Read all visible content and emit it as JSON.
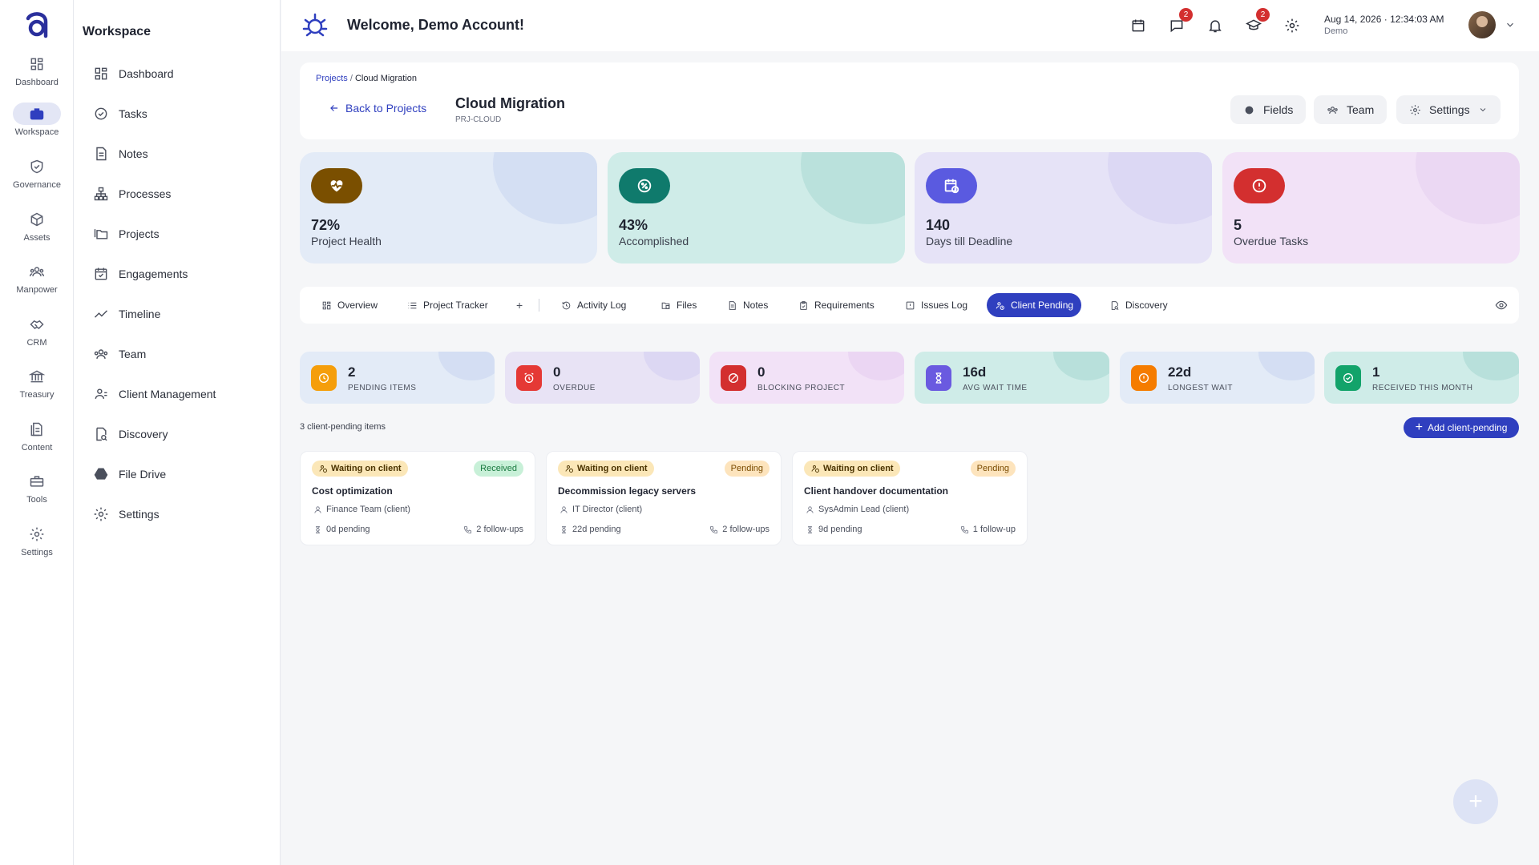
{
  "rail": {
    "items": [
      {
        "label": "Dashboard",
        "icon": "dashboard-icon"
      },
      {
        "label": "Workspace",
        "icon": "briefcase-icon",
        "active": true
      },
      {
        "label": "Governance",
        "icon": "shield-icon"
      },
      {
        "label": "Assets",
        "icon": "cube-icon"
      },
      {
        "label": "Manpower",
        "icon": "people-icon"
      },
      {
        "label": "CRM",
        "icon": "handshake-icon"
      },
      {
        "label": "Treasury",
        "icon": "bank-icon"
      },
      {
        "label": "Content",
        "icon": "document-icon"
      },
      {
        "label": "Tools",
        "icon": "toolbox-icon"
      },
      {
        "label": "Settings",
        "icon": "gear-icon"
      }
    ]
  },
  "sidebar": {
    "title": "Workspace",
    "items": [
      {
        "label": "Dashboard",
        "icon": "dashboard-icon"
      },
      {
        "label": "Tasks",
        "icon": "check-circle-icon"
      },
      {
        "label": "Notes",
        "icon": "note-icon"
      },
      {
        "label": "Processes",
        "icon": "org-chart-icon"
      },
      {
        "label": "Projects",
        "icon": "folders-icon"
      },
      {
        "label": "Engagements",
        "icon": "calendar-check-icon"
      },
      {
        "label": "Timeline",
        "icon": "trend-line-icon"
      },
      {
        "label": "Team",
        "icon": "team-icon"
      },
      {
        "label": "Client Management",
        "icon": "client-icon"
      },
      {
        "label": "Discovery",
        "icon": "search-doc-icon"
      },
      {
        "label": "File Drive",
        "icon": "drive-icon"
      },
      {
        "label": "Settings",
        "icon": "gear-icon"
      }
    ]
  },
  "topbar": {
    "welcome": "Welcome, Demo Account!",
    "messages_badge": "2",
    "learning_badge": "2",
    "date": "Aug 14, 2026",
    "time": "12:34:03 AM",
    "user": "Demo"
  },
  "project": {
    "breadcrumb_parent": "Projects",
    "breadcrumb_sep": "/",
    "breadcrumb_current": "Cloud Migration",
    "back_label": "Back to Projects",
    "title": "Cloud Migration",
    "code": "PRJ-CLOUD",
    "buttons": {
      "fields": "Fields",
      "team": "Team",
      "settings": "Settings"
    }
  },
  "stats": [
    {
      "value": "72%",
      "label": "Project Health",
      "icon": "heart-pulse-icon",
      "bg": "#e3ebf7",
      "accent": "#7a4f00",
      "blob": "#c9d6f0"
    },
    {
      "value": "43%",
      "label": "Accomplished",
      "icon": "percent-icon",
      "bg": "#cfece8",
      "accent": "#0f7a6c",
      "blob": "#a9d8d2"
    },
    {
      "value": "140",
      "label": "Days till Deadline",
      "icon": "calendar-clock-icon",
      "bg": "#e6e3f7",
      "accent": "#5a5ae0",
      "blob": "#d4cff2"
    },
    {
      "value": "5",
      "label": "Overdue Tasks",
      "icon": "alert-icon",
      "bg": "#f2e2f7",
      "accent": "#d32f2f",
      "blob": "#e6cff0"
    }
  ],
  "tabs": [
    {
      "label": "Overview",
      "icon": "grid-icon"
    },
    {
      "label": "Project Tracker",
      "icon": "list-icon"
    },
    {
      "label": "+",
      "icon": ""
    },
    {
      "label": "Activity Log",
      "icon": "history-icon"
    },
    {
      "label": "Files",
      "icon": "files-icon"
    },
    {
      "label": "Notes",
      "icon": "note-icon"
    },
    {
      "label": "Requirements",
      "icon": "clipboard-icon"
    },
    {
      "label": "Issues Log",
      "icon": "issue-icon"
    },
    {
      "label": "Client Pending",
      "icon": "client-wait-icon",
      "active": true
    },
    {
      "label": "Discovery",
      "icon": "search-doc-icon"
    }
  ],
  "mini_stats": [
    {
      "value": "2",
      "label": "PENDING ITEMS",
      "icon": "clock-icon",
      "bg": "#e3ebf7",
      "accent": "#f59e0b",
      "blob": "#c9d6f0"
    },
    {
      "value": "0",
      "label": "OVERDUE",
      "icon": "alarm-icon",
      "bg": "#e8e3f5",
      "accent": "#e53935",
      "blob": "#d4cff2"
    },
    {
      "value": "0",
      "label": "BLOCKING PROJECT",
      "icon": "block-icon",
      "bg": "#f2e2f7",
      "accent": "#d32f2f",
      "blob": "#e6cff0"
    },
    {
      "value": "16d",
      "label": "AVG WAIT TIME",
      "icon": "hourglass-icon",
      "bg": "#cfece8",
      "accent": "#6a5ae0",
      "blob": "#a9d8d2"
    },
    {
      "value": "22d",
      "label": "LONGEST WAIT",
      "icon": "warning-icon",
      "bg": "#e3ebf7",
      "accent": "#f57c00",
      "blob": "#c9d6f0"
    },
    {
      "value": "1",
      "label": "RECEIVED THIS MONTH",
      "icon": "check-icon",
      "bg": "#cfece8",
      "accent": "#12a36a",
      "blob": "#a9d8d2"
    }
  ],
  "list": {
    "count_label": "3 client-pending items",
    "add_label": "Add client-pending",
    "waiting_label": "Waiting on client",
    "items": [
      {
        "title": "Cost optimization",
        "status": "Received",
        "status_kind": "received",
        "owner": "Finance Team (client)",
        "pending": "0d pending",
        "followups": "2 follow-ups"
      },
      {
        "title": "Decommission legacy servers",
        "status": "Pending",
        "status_kind": "pending",
        "owner": "IT Director (client)",
        "pending": "22d pending",
        "followups": "2 follow-ups"
      },
      {
        "title": "Client handover documentation",
        "status": "Pending",
        "status_kind": "pending",
        "owner": "SysAdmin Lead (client)",
        "pending": "9d pending",
        "followups": "1 follow-up"
      }
    ]
  },
  "fab_label": "+"
}
